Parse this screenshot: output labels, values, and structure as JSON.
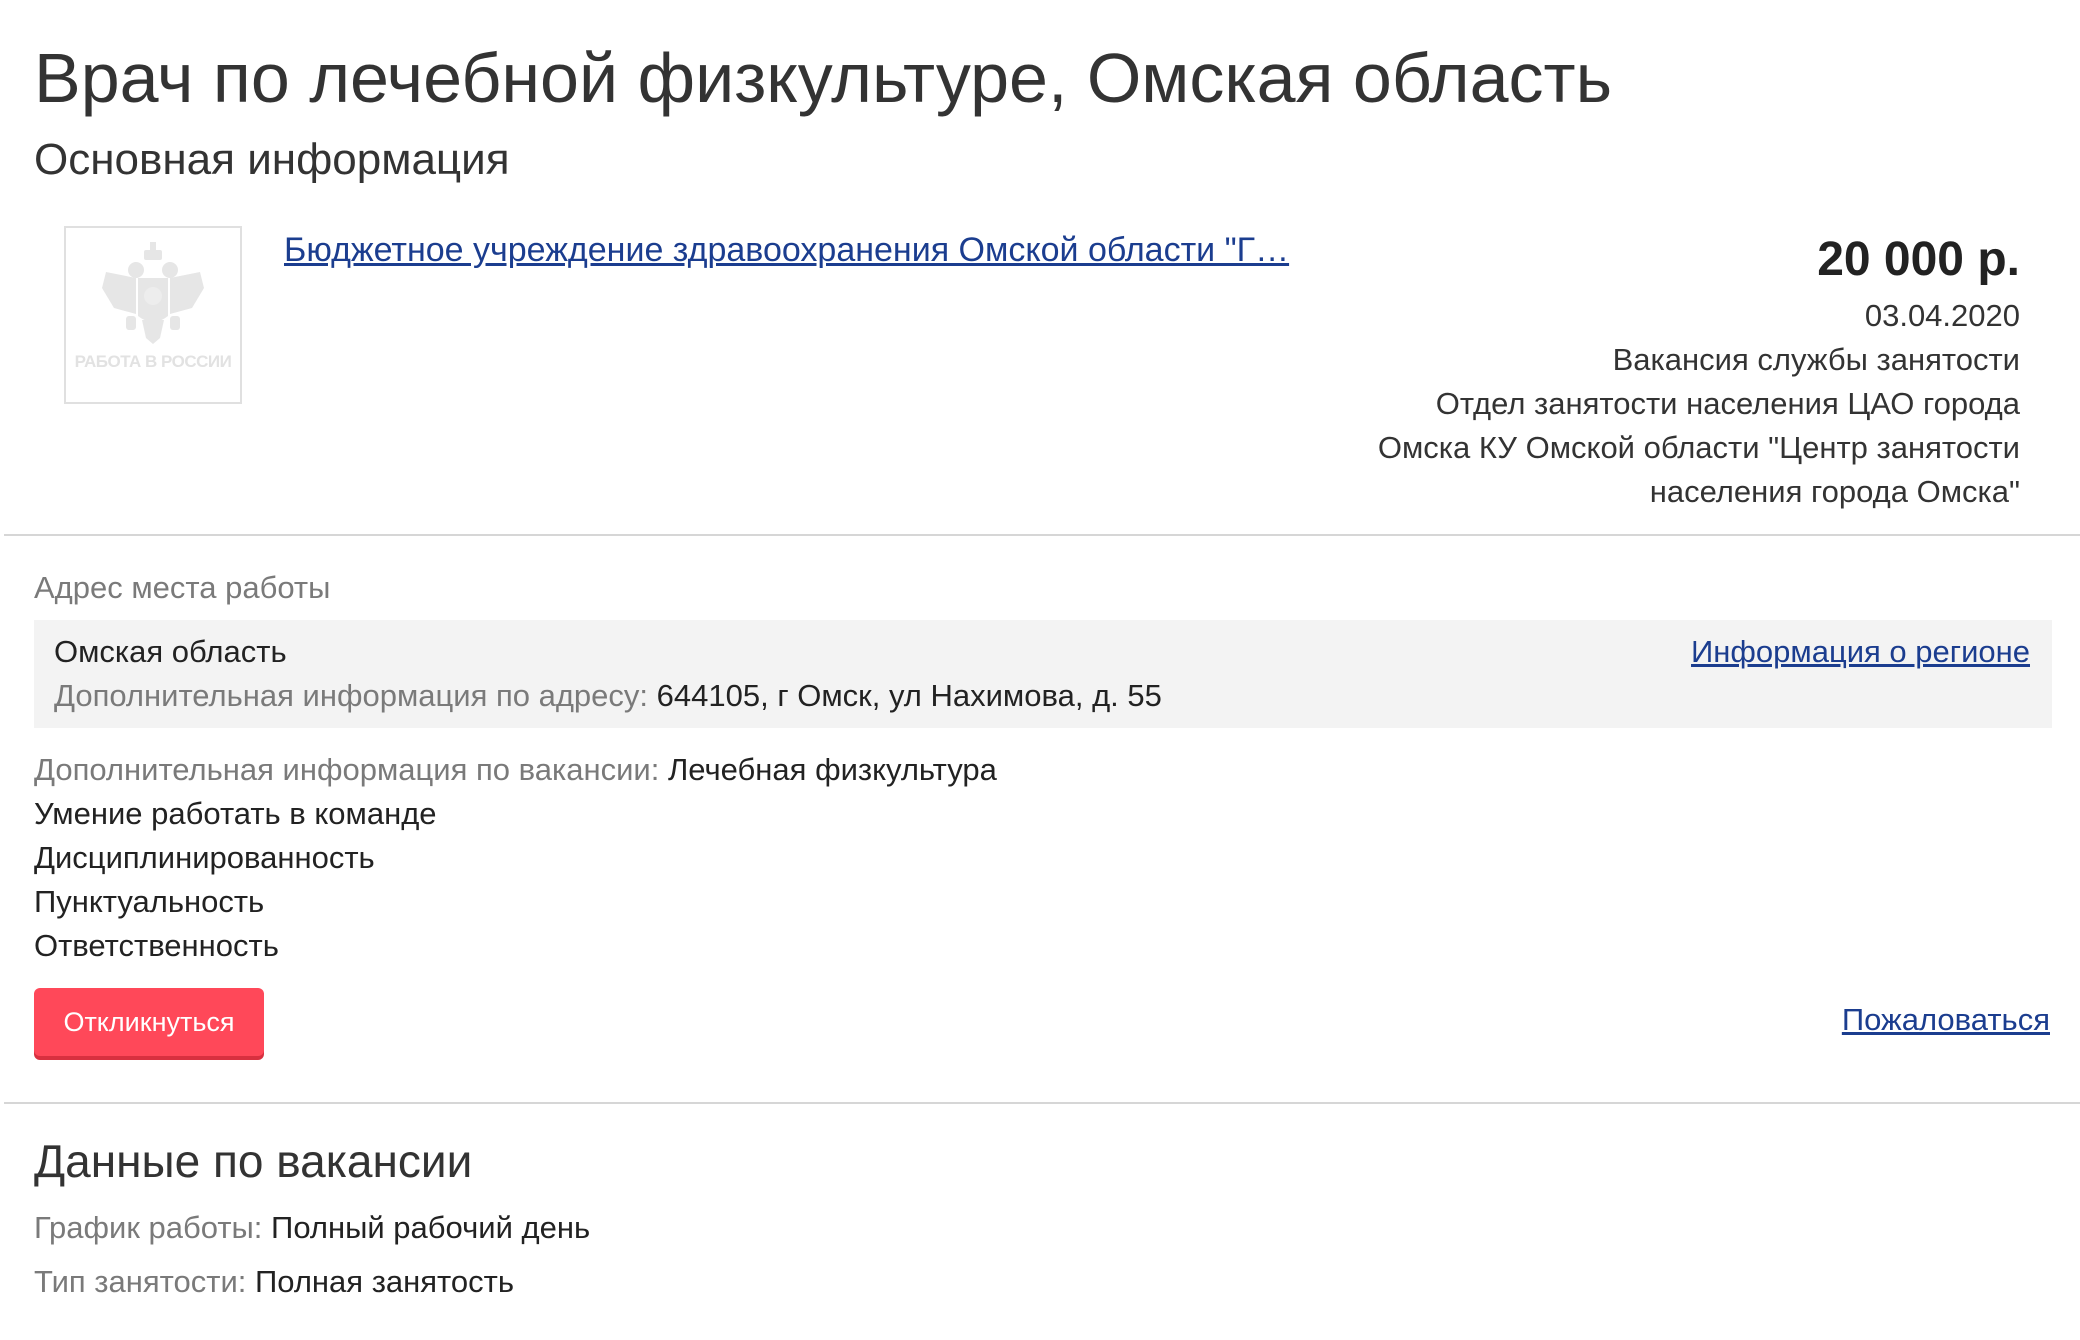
{
  "header": {
    "title": "Врач по лечебной физкультуре, Омская область",
    "subtitle": "Основная информация"
  },
  "employer": {
    "logo_text": "РАБОТА В РОССИИ",
    "name": "Бюджетное учреждение здравоохранения Омской области \"Г…"
  },
  "meta": {
    "salary": "20 000 р.",
    "date": "03.04.2020",
    "source": "Вакансия службы занятости",
    "office_lines": [
      "Отдел занятости населения ЦАО города",
      "Омска КУ Омской области \"Центр занятости",
      "населения города Омска\""
    ]
  },
  "address": {
    "caption": "Адрес места работы",
    "region": "Омская область",
    "extra_label": "Дополнительная информация по адресу:",
    "extra_value": "644105, г Омск, ул Нахимова, д. 55",
    "region_link": "Информация о регионе"
  },
  "vacancy_info": {
    "label": "Дополнительная информация по вакансии:",
    "lines": [
      "Лечебная физкультура",
      "Умение работать в команде",
      "Дисциплинированность",
      "Пунктуальность",
      "Ответственность"
    ]
  },
  "actions": {
    "respond_label": "Откликнуться",
    "complain_label": "Пожаловаться"
  },
  "vacancy_data": {
    "heading": "Данные по вакансии",
    "schedule_label": "График работы:",
    "schedule_value": "Полный рабочий день",
    "employment_label": "Тип занятости:",
    "employment_value": "Полная занятость"
  },
  "colors": {
    "link": "#1b3d8f",
    "accent_button": "#ff4859",
    "muted_text": "#7a7a7a",
    "panel_bg": "#f3f3f3"
  }
}
